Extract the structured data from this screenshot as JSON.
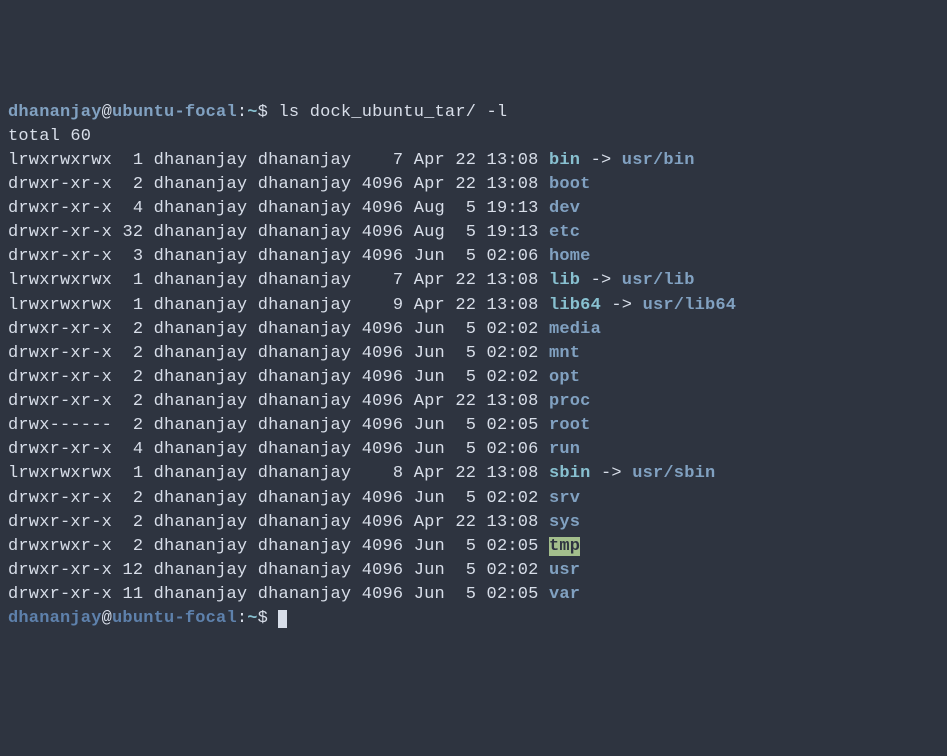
{
  "prompt": {
    "user": "dhananjay",
    "at": "@",
    "host": "ubuntu-focal",
    "colon": ":",
    "tilde": "~",
    "dollar": "$ ",
    "command": "ls dock_ubuntu_tar/ -l"
  },
  "total": "total 60",
  "rows": [
    {
      "perm": "lrwxrwxrwx",
      "links": " 1",
      "owner": "dhananjay",
      "group": "dhananjay",
      "size": "   7",
      "date": "Apr 22 13:08",
      "name": "bin",
      "cls": "lnk",
      "arrow": " -> ",
      "target": "usr/bin"
    },
    {
      "perm": "drwxr-xr-x",
      "links": " 2",
      "owner": "dhananjay",
      "group": "dhananjay",
      "size": "4096",
      "date": "Apr 22 13:08",
      "name": "boot",
      "cls": "dir"
    },
    {
      "perm": "drwxr-xr-x",
      "links": " 4",
      "owner": "dhananjay",
      "group": "dhananjay",
      "size": "4096",
      "date": "Aug  5 19:13",
      "name": "dev",
      "cls": "dir"
    },
    {
      "perm": "drwxr-xr-x",
      "links": "32",
      "owner": "dhananjay",
      "group": "dhananjay",
      "size": "4096",
      "date": "Aug  5 19:13",
      "name": "etc",
      "cls": "dir"
    },
    {
      "perm": "drwxr-xr-x",
      "links": " 3",
      "owner": "dhananjay",
      "group": "dhananjay",
      "size": "4096",
      "date": "Jun  5 02:06",
      "name": "home",
      "cls": "dir"
    },
    {
      "perm": "lrwxrwxrwx",
      "links": " 1",
      "owner": "dhananjay",
      "group": "dhananjay",
      "size": "   7",
      "date": "Apr 22 13:08",
      "name": "lib",
      "cls": "lnk",
      "arrow": " -> ",
      "target": "usr/lib"
    },
    {
      "perm": "lrwxrwxrwx",
      "links": " 1",
      "owner": "dhananjay",
      "group": "dhananjay",
      "size": "   9",
      "date": "Apr 22 13:08",
      "name": "lib64",
      "cls": "lnk",
      "arrow": " -> ",
      "target": "usr/lib64"
    },
    {
      "perm": "drwxr-xr-x",
      "links": " 2",
      "owner": "dhananjay",
      "group": "dhananjay",
      "size": "4096",
      "date": "Jun  5 02:02",
      "name": "media",
      "cls": "dir"
    },
    {
      "perm": "drwxr-xr-x",
      "links": " 2",
      "owner": "dhananjay",
      "group": "dhananjay",
      "size": "4096",
      "date": "Jun  5 02:02",
      "name": "mnt",
      "cls": "dir"
    },
    {
      "perm": "drwxr-xr-x",
      "links": " 2",
      "owner": "dhananjay",
      "group": "dhananjay",
      "size": "4096",
      "date": "Jun  5 02:02",
      "name": "opt",
      "cls": "dir"
    },
    {
      "perm": "drwxr-xr-x",
      "links": " 2",
      "owner": "dhananjay",
      "group": "dhananjay",
      "size": "4096",
      "date": "Apr 22 13:08",
      "name": "proc",
      "cls": "dir"
    },
    {
      "perm": "drwx------",
      "links": " 2",
      "owner": "dhananjay",
      "group": "dhananjay",
      "size": "4096",
      "date": "Jun  5 02:05",
      "name": "root",
      "cls": "dir"
    },
    {
      "perm": "drwxr-xr-x",
      "links": " 4",
      "owner": "dhananjay",
      "group": "dhananjay",
      "size": "4096",
      "date": "Jun  5 02:06",
      "name": "run",
      "cls": "dir"
    },
    {
      "perm": "lrwxrwxrwx",
      "links": " 1",
      "owner": "dhananjay",
      "group": "dhananjay",
      "size": "   8",
      "date": "Apr 22 13:08",
      "name": "sbin",
      "cls": "lnk",
      "arrow": " -> ",
      "target": "usr/sbin"
    },
    {
      "perm": "drwxr-xr-x",
      "links": " 2",
      "owner": "dhananjay",
      "group": "dhananjay",
      "size": "4096",
      "date": "Jun  5 02:02",
      "name": "srv",
      "cls": "dir"
    },
    {
      "perm": "drwxr-xr-x",
      "links": " 2",
      "owner": "dhananjay",
      "group": "dhananjay",
      "size": "4096",
      "date": "Apr 22 13:08",
      "name": "sys",
      "cls": "dir"
    },
    {
      "perm": "drwxrwxr-x",
      "links": " 2",
      "owner": "dhananjay",
      "group": "dhananjay",
      "size": "4096",
      "date": "Jun  5 02:05",
      "name": "tmp",
      "cls": "sticky"
    },
    {
      "perm": "drwxr-xr-x",
      "links": "12",
      "owner": "dhananjay",
      "group": "dhananjay",
      "size": "4096",
      "date": "Jun  5 02:02",
      "name": "usr",
      "cls": "dir"
    },
    {
      "perm": "drwxr-xr-x",
      "links": "11",
      "owner": "dhananjay",
      "group": "dhananjay",
      "size": "4096",
      "date": "Jun  5 02:05",
      "name": "var",
      "cls": "dir"
    }
  ]
}
